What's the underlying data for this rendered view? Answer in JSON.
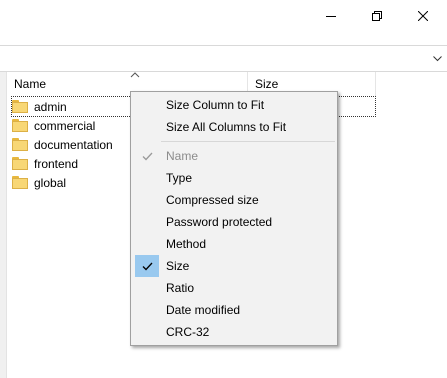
{
  "window": {
    "controls": [
      "minimize",
      "maximize",
      "close"
    ]
  },
  "filelist": {
    "columns": [
      {
        "label": "Name"
      },
      {
        "label": "Size"
      }
    ],
    "rows": [
      {
        "name": "admin",
        "icon": "folder-icon",
        "selected": true
      },
      {
        "name": "commercial",
        "icon": "folder-icon"
      },
      {
        "name": "documentation",
        "icon": "folder-icon"
      },
      {
        "name": "frontend",
        "icon": "folder-icon"
      },
      {
        "name": "global",
        "icon": "folder-icon"
      }
    ]
  },
  "context_menu": {
    "top_items": [
      {
        "label": "Size Column to Fit"
      },
      {
        "label": "Size All Columns to Fit"
      }
    ],
    "column_items": [
      {
        "label": "Name",
        "checked": true,
        "disabled": true
      },
      {
        "label": "Type",
        "checked": false
      },
      {
        "label": "Compressed size",
        "checked": false
      },
      {
        "label": "Password protected",
        "checked": false
      },
      {
        "label": "Method",
        "checked": false
      },
      {
        "label": "Size",
        "checked": true
      },
      {
        "label": "Ratio",
        "checked": false
      },
      {
        "label": "Date modified",
        "checked": false
      },
      {
        "label": "CRC-32",
        "checked": false
      }
    ]
  },
  "colors": {
    "check_highlight": "#99c9ef",
    "menu_background": "#f2f2f2",
    "folder": "#f8d775",
    "disabled_text": "#8c8c8c"
  }
}
